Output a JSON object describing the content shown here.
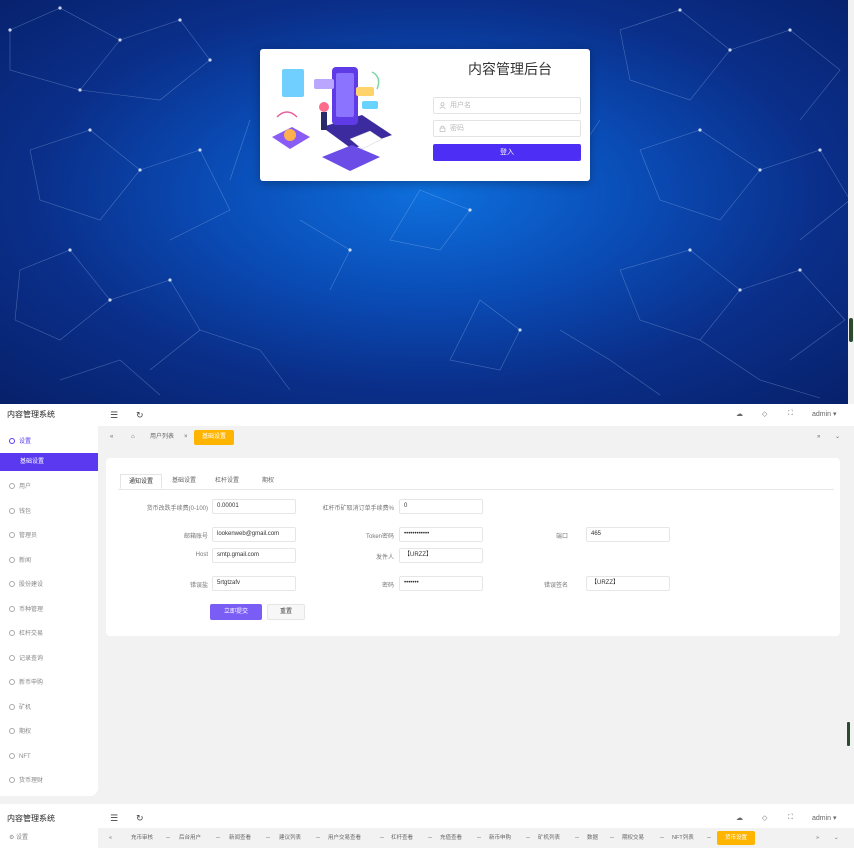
{
  "login": {
    "title": "内容管理后台",
    "username_placeholder": "用户名",
    "password_placeholder": "密码",
    "login_button": "登入"
  },
  "admin": {
    "brand": "内容管理系统",
    "user": "admin ▾",
    "sidebar": {
      "items": [
        "设置",
        "基础设置",
        "用户",
        "钱包",
        "管理员",
        "新闻",
        "股份建设",
        "币种管理",
        "杠杆交易",
        "记录查询",
        "新币申购",
        "矿机",
        "期权",
        "NFT",
        "货币理财"
      ]
    },
    "breadcrumb": [
      "用户列表",
      "基础设置"
    ],
    "content_tabs": [
      "通知设置",
      "基础设置",
      "杠杆设置",
      "期权"
    ],
    "form": {
      "fields": [
        {
          "label": "货币改跌手续费(0-100)",
          "value": "0.00001"
        },
        {
          "label": "杠杆币矿取消订单手续费%",
          "value": "0"
        },
        {
          "label": "邮箱账号",
          "value": "lookenweb@gmail.com"
        },
        {
          "label": "Token密码",
          "value": "••••••••••••"
        },
        {
          "label": "端口",
          "value": "465"
        },
        {
          "label": "Host",
          "value": "smtp.gmail.com"
        },
        {
          "label": "发件人",
          "value": "【URZZ】"
        },
        {
          "label": "错误盐",
          "value": "5rtgtzafv"
        },
        {
          "label": "密码",
          "value": "•••••••"
        },
        {
          "label": "错误签名",
          "value": "【URZZ】"
        }
      ],
      "submit": "立即提交",
      "reset": "重置"
    }
  },
  "mini": {
    "brand": "内容管理系统",
    "side_item": "设置",
    "user": "admin ▾",
    "tabs": [
      "充币审核",
      "后台用户",
      "新闻查看",
      "建议列表",
      "用户交易查看",
      "杠杆查看",
      "充值查看",
      "新币申购",
      "矿机列表",
      "数据",
      "期权交易",
      "NFT列表",
      "货币设置"
    ]
  }
}
